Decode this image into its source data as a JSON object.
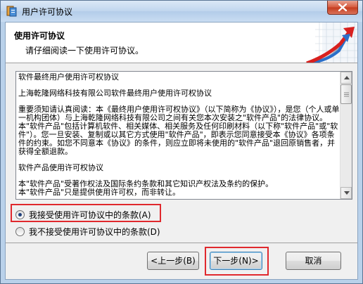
{
  "window": {
    "title": "用户许可协议"
  },
  "header": {
    "title": "使用许可协议",
    "subtitle": "请仔细阅读一下使用许可协议。"
  },
  "license": {
    "paragraphs": [
      "软件最终用户使用许可权协议",
      "上海乾隆网络科技有限公司软件最终用户使用许可权协议",
      "重要须知请认真阅读：本《最终用户使用许可权协议》（以下简称为《协议》），是您（个人或单一机构团体）与上海乾隆网络科技有限公司之间有关您本次安装之\"软件产品\"的法律协议。本\"软件产品\"包括计算机软件、相关媒体、相关服务及任何印刷材料（以下称\"软件产品\"或\"软件\"）。您一旦安装、复制或以其它方式使用\"软件产品\"，即表示您同意接受本《协议》各项条件的约束。如您不同意本《协议》的条件，则应立即将未使用的\"软件产品\"退回原销售者，并获得全额退款。",
      "软件产品使用许可权协议",
      "本\"软件产品\"受著作权法及国际条约条款和其它知识产权法及条约的保护。",
      "本\"软件产品\"只是提供使用许可权，而非转让。"
    ]
  },
  "options": {
    "accept_label": "我接受使用许可协议中的条款(A)",
    "decline_label": "我不接受使用许可协议中的条款(D)",
    "selected": "accept"
  },
  "buttons": {
    "back_label": "<上一步(B)",
    "next_label": "下一步(N)>",
    "cancel_label": "取消"
  },
  "colors": {
    "highlight": "#e0282d",
    "accent": "#1f5fa8"
  }
}
